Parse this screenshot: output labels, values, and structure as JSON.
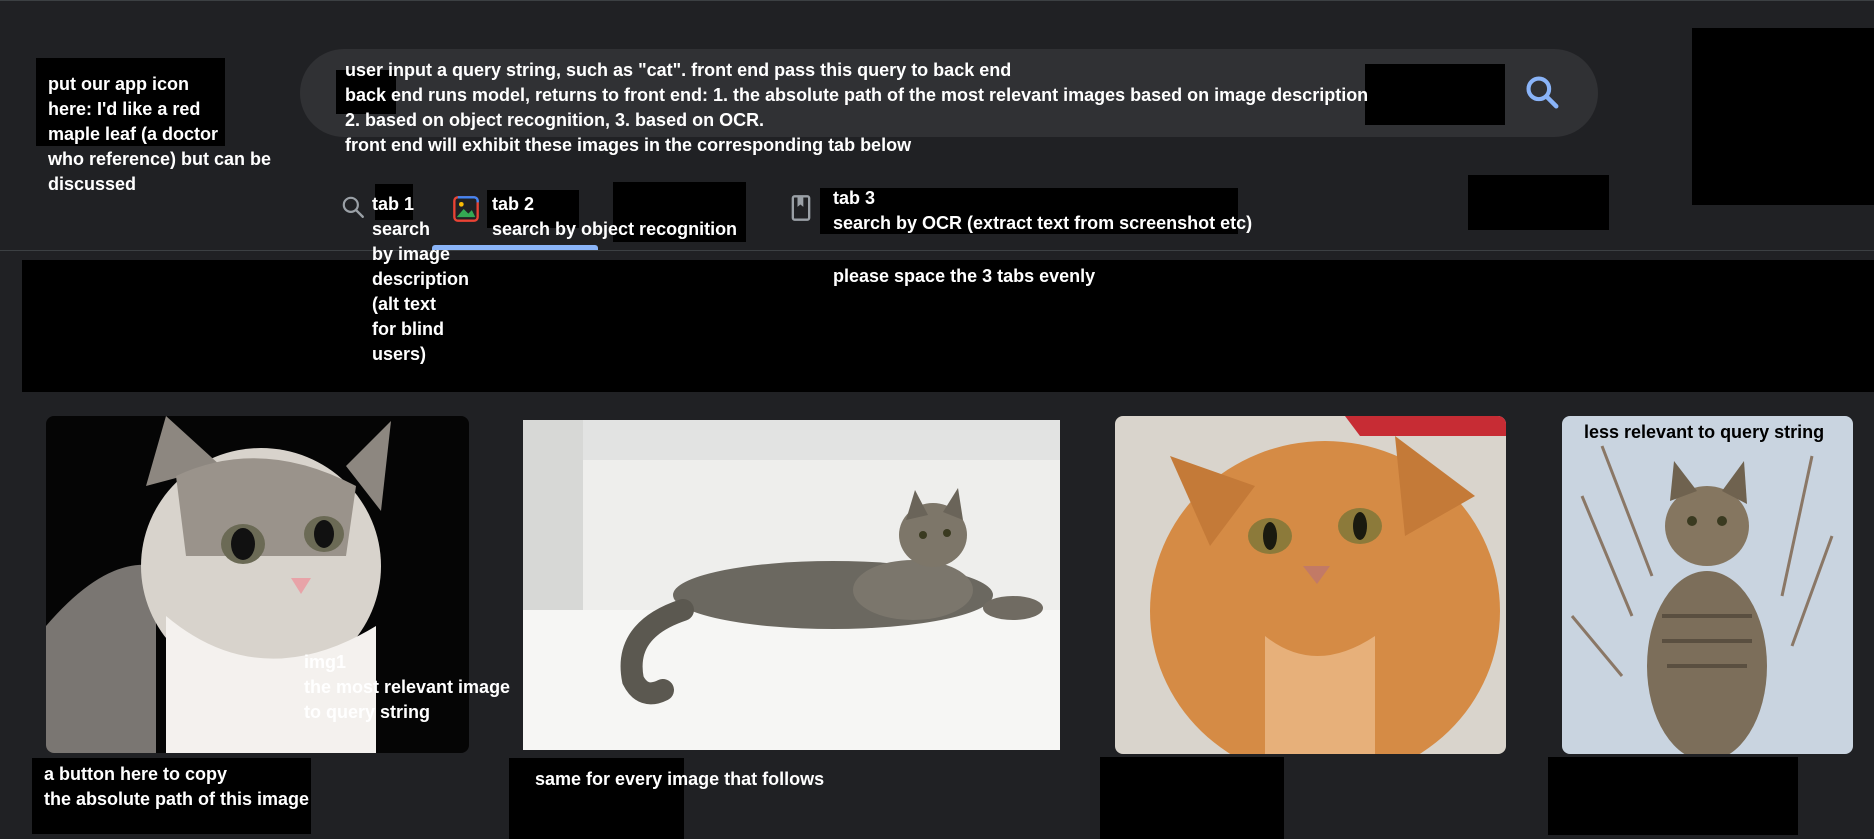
{
  "app_icon_note": "put our app icon\nhere: I'd like a red\nmaple leaf (a doctor\nwho reference) but can be\ndiscussed",
  "search": {
    "query_note": "user input a query string, such as \"cat\". front end pass this query to back end\nback end runs model, returns to front end: 1. the absolute path of the most relevant images based on image description\n2. based on object recognition, 3. based on OCR.\nfront end will exhibit these images in the corresponding tab below",
    "button_icon": "search-icon"
  },
  "tabs": [
    {
      "label": "tab 1\nsearch\nby image\ndescription\n(alt text\nfor blind\nusers)",
      "icon": "search-icon"
    },
    {
      "label": "tab 2\nsearch by object recognition",
      "icon": "image-icon",
      "active": true
    },
    {
      "label": "tab 3\nsearch by OCR (extract text from screenshot etc)",
      "icon": "bookmark-icon"
    }
  ],
  "tabs_note": "please space the 3 tabs evenly",
  "results": {
    "img1_note": "img1\nthe most relevant image\nto query string",
    "last_note": "less relevant to query string",
    "copy_note": "a button here to copy\nthe absolute path of this image",
    "same_note": "same for every image that follows"
  },
  "colors": {
    "background": "#202124",
    "search_pill": "#303134",
    "accent": "#8ab4f8"
  }
}
